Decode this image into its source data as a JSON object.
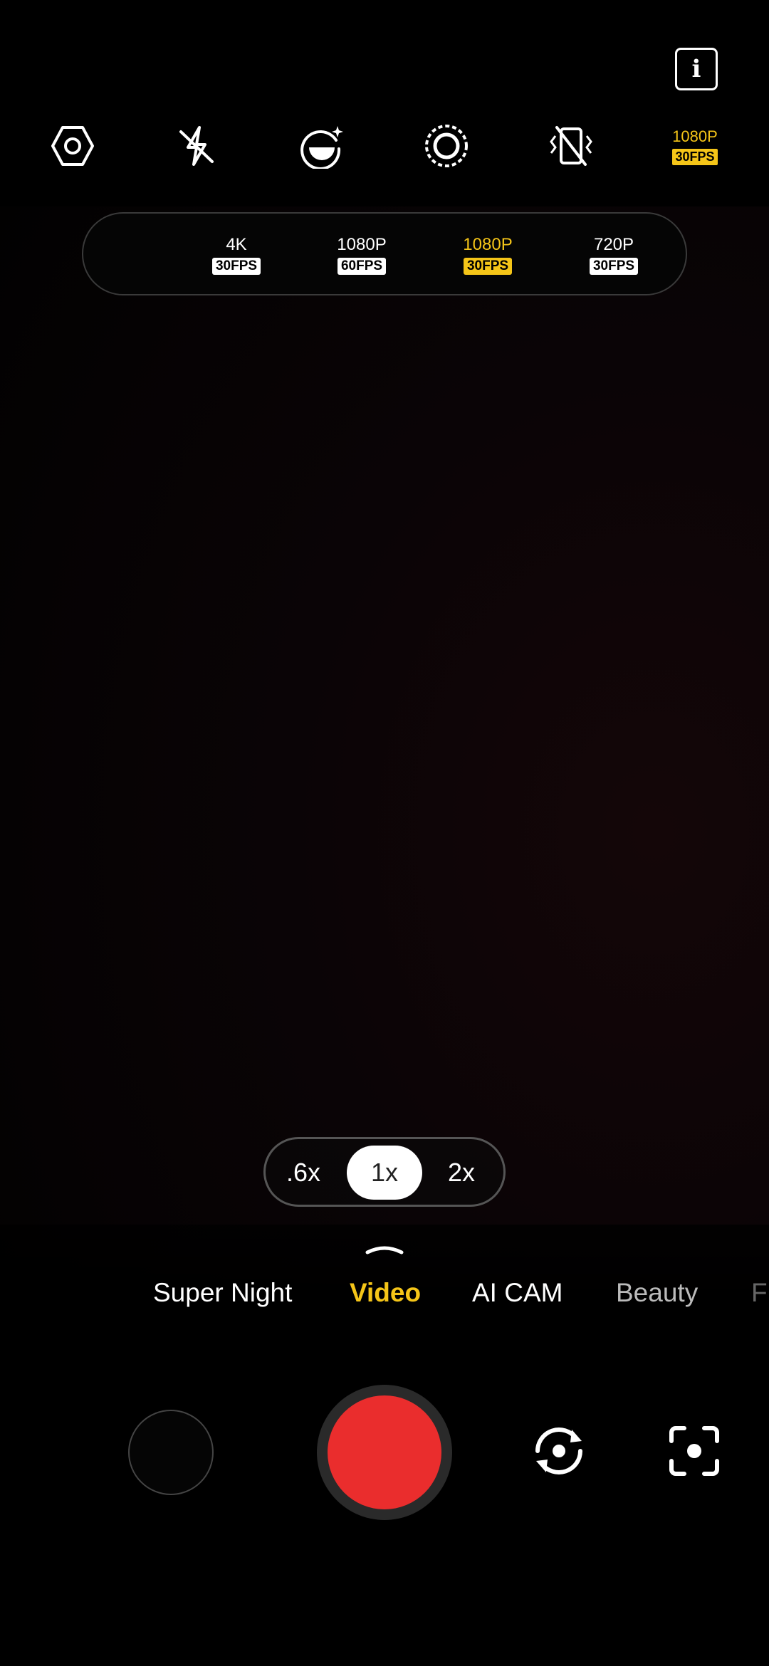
{
  "top": {
    "info_icon": "info-icon",
    "toolbar": [
      {
        "name": "settings-icon"
      },
      {
        "name": "flash-off-icon"
      },
      {
        "name": "beauty-face-icon"
      },
      {
        "name": "focus-mode-icon"
      },
      {
        "name": "stabilization-off-icon"
      }
    ],
    "current_resolution": {
      "res": "1080P",
      "fps": "30FPS"
    }
  },
  "resolution_options": [
    {
      "res": "4K",
      "fps": "30FPS",
      "selected": false
    },
    {
      "res": "1080P",
      "fps": "60FPS",
      "selected": false
    },
    {
      "res": "1080P",
      "fps": "30FPS",
      "selected": true
    },
    {
      "res": "720P",
      "fps": "30FPS",
      "selected": false
    }
  ],
  "zoom": {
    "options": [
      ".6x",
      "1x",
      "2x"
    ],
    "selected": "1x"
  },
  "modes": [
    "Super Night",
    "Video",
    "AI CAM",
    "Beauty",
    "F"
  ],
  "active_mode": "Video",
  "colors": {
    "accent": "#f5c518",
    "record": "#ea2d2d",
    "background": "#000000"
  },
  "bottom": {
    "thumbnail": "gallery-thumbnail",
    "shutter": "record-button",
    "flip_icon": "switch-camera-icon",
    "lens_icon": "lens-scan-icon"
  }
}
